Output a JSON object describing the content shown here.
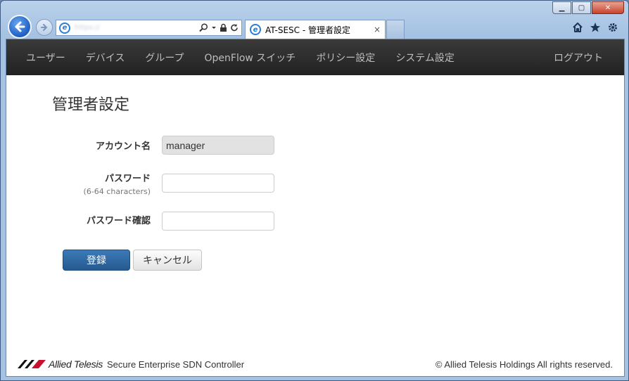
{
  "browser": {
    "window_controls": {
      "minimize": "▁",
      "maximize": "▢",
      "close": "✕"
    },
    "address_url": "https://",
    "tab": {
      "title": "AT-SESC - 管理者設定",
      "close": "×"
    },
    "icons": [
      "home-icon",
      "star-icon",
      "gear-icon"
    ]
  },
  "navbar": {
    "items": [
      "ユーザー",
      "デバイス",
      "グループ",
      "OpenFlow スイッチ",
      "ポリシー設定",
      "システム設定"
    ],
    "logout": "ログアウト"
  },
  "page": {
    "title": "管理者設定",
    "form": {
      "account_label": "アカウント名",
      "account_value": "manager",
      "password_label": "パスワード",
      "password_hint": "(6-64 characters)",
      "password_value": "",
      "confirm_label": "パスワード確認",
      "confirm_value": ""
    },
    "buttons": {
      "submit": "登録",
      "cancel": "キャンセル"
    }
  },
  "footer": {
    "brand": "Allied Telesis",
    "product": "Secure Enterprise SDN Controller",
    "copyright": "© Allied Telesis Holdings All rights reserved."
  },
  "colors": {
    "navbar": "#2b2b2b",
    "primary_button": "#2f6aa3",
    "readonly_field": "#e2e2e2"
  }
}
